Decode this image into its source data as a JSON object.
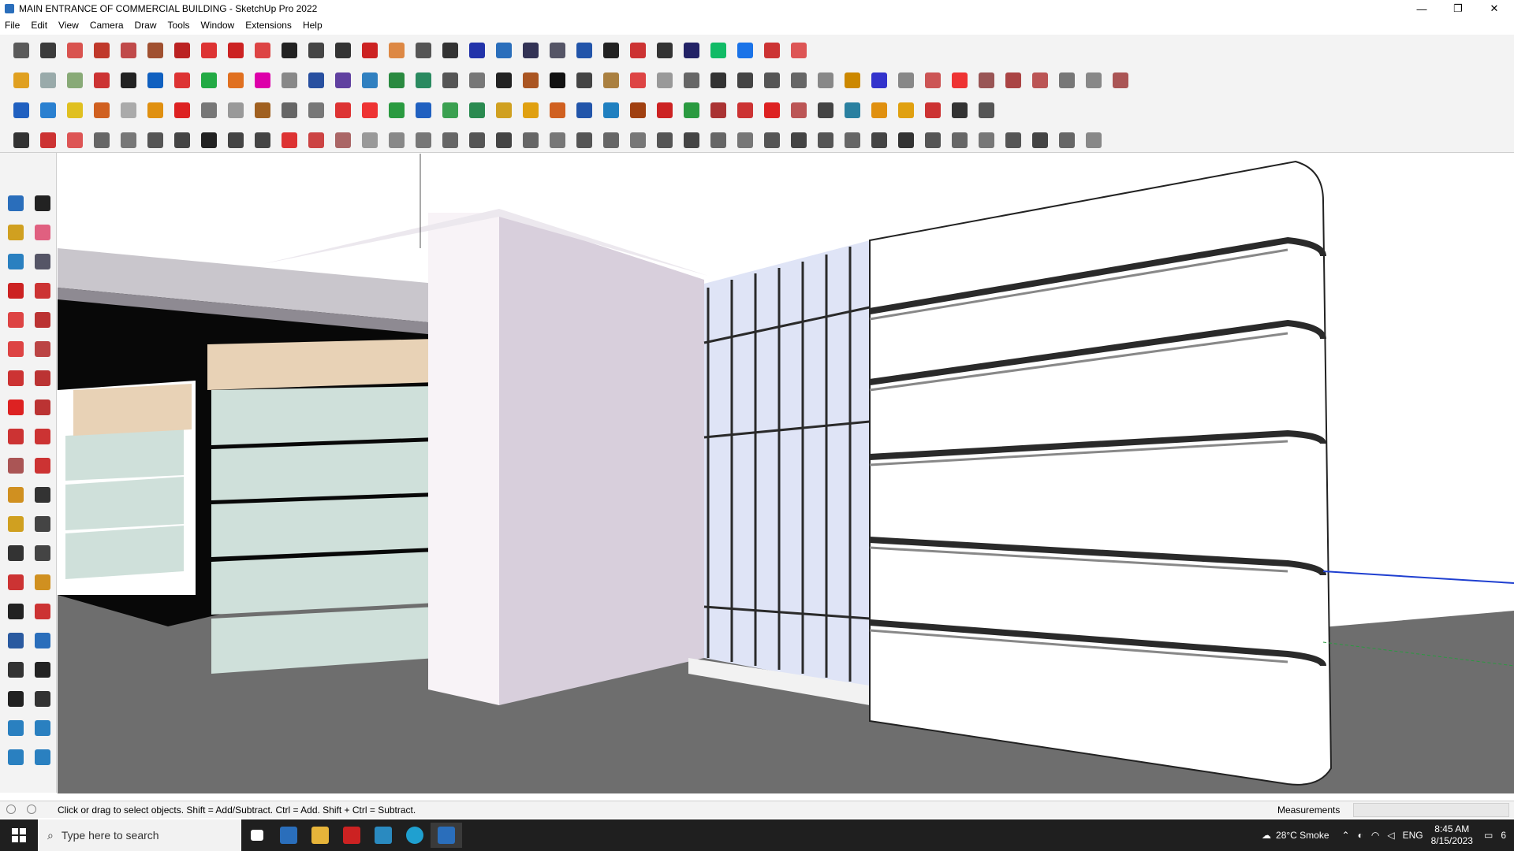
{
  "window": {
    "title": "MAIN ENTRANCE OF COMMERCIAL BUILDING - SketchUp Pro 2022",
    "minimize": "—",
    "restore": "❐",
    "close": "✕"
  },
  "menu": [
    "File",
    "Edit",
    "View",
    "Camera",
    "Draw",
    "Tools",
    "Window",
    "Extensions",
    "Help"
  ],
  "toolbar_row_colors": {
    "row1": [
      "#5a5a5a",
      "#3b3b3b",
      "#d9534f",
      "#c0392b",
      "#c04a4a",
      "#a05030",
      "#b22",
      "#d33",
      "#c22",
      "#d44",
      "#222",
      "#444",
      "#333",
      "#c22",
      "#d84",
      "#555",
      "#333",
      "#23a",
      "#2a6ebb",
      "#335",
      "#556",
      "#2255aa",
      "#222",
      "#c33",
      "#333",
      "#226",
      "#1b6",
      "#1a73e8",
      "#c33",
      "#d55"
    ],
    "row2": [
      "#e0a020",
      "#9aa",
      "#8a7",
      "#c33",
      "#222",
      "#1060c0",
      "#d33",
      "#2a4",
      "#e07020",
      "#d0a",
      "#888",
      "#2850a0",
      "#6040a0",
      "#3080c0",
      "#2a8a40",
      "#2a8a60",
      "#555",
      "#777",
      "#222",
      "#a52",
      "#111",
      "#444",
      "#aa8040",
      "#d44",
      "#999",
      "#666",
      "#333",
      "#444",
      "#555",
      "#666",
      "#888",
      "#c80",
      "#33c",
      "#888",
      "#c55",
      "#e33",
      "#955",
      "#a44",
      "#b55",
      "#777",
      "#888",
      "#a55"
    ],
    "row3": [
      "#2060c0",
      "#2a80d0",
      "#e0c020",
      "#d06020",
      "#aaa",
      "#e09010",
      "#d22",
      "#777",
      "#999",
      "#a06020",
      "#666",
      "#777",
      "#d33",
      "#e33",
      "#2a9a40",
      "#2060c0",
      "#3aa050",
      "#2a8a50",
      "#d0a020",
      "#e0a010",
      "#d06020",
      "#2255aa",
      "#2080c0",
      "#a04010",
      "#c22",
      "#2a9a40",
      "#a33",
      "#c33",
      "#d22",
      "#b55",
      "#444",
      "#2a80a0",
      "#e09010",
      "#e0a010",
      "#c33",
      "#333",
      "#555"
    ],
    "row4": [
      "#333",
      "#c33",
      "#d55",
      "#666",
      "#777",
      "#555",
      "#444",
      "#222",
      "#444",
      "#444",
      "#d33",
      "#c44",
      "#a66",
      "#999",
      "#888",
      "#777",
      "#666",
      "#555",
      "#444",
      "#666",
      "#777",
      "#555",
      "#666",
      "#777",
      "#555",
      "#444",
      "#666",
      "#777",
      "#555",
      "#444",
      "#555",
      "#666",
      "#444",
      "#333",
      "#555",
      "#666",
      "#777",
      "#555",
      "#444",
      "#666",
      "#888"
    ]
  },
  "sidebar_colors": [
    "#2a6ebb",
    "#222",
    "#d0a020",
    "#e06080",
    "#2a80c0",
    "#556",
    "#c22",
    "#c33",
    "#d44",
    "#b33",
    "#d44",
    "#b44",
    "#c33",
    "#b33",
    "#d22",
    "#b33",
    "#c33",
    "#c33",
    "#a55",
    "#c33",
    "#d09020",
    "#333",
    "#d0a020",
    "#444",
    "#333",
    "#444",
    "#c33",
    "#d09020",
    "#222",
    "#c33",
    "#2a5aa0",
    "#2a6ebb",
    "#333",
    "#222",
    "#222",
    "#333",
    "#2a80c0",
    "#2a80c0",
    "#2a80c0",
    "#2a80c0"
  ],
  "statusbar": {
    "hint": "Click or drag to select objects. Shift = Add/Subtract. Ctrl = Add. Shift + Ctrl = Subtract.",
    "measurements_label": "Measurements",
    "measurements_value": ""
  },
  "taskbar": {
    "search_placeholder": "Type here to search",
    "weather": "28°C  Smoke",
    "language": "ENG",
    "time": "8:45 AM",
    "date": "8/15/2023",
    "notification_count": "6"
  }
}
